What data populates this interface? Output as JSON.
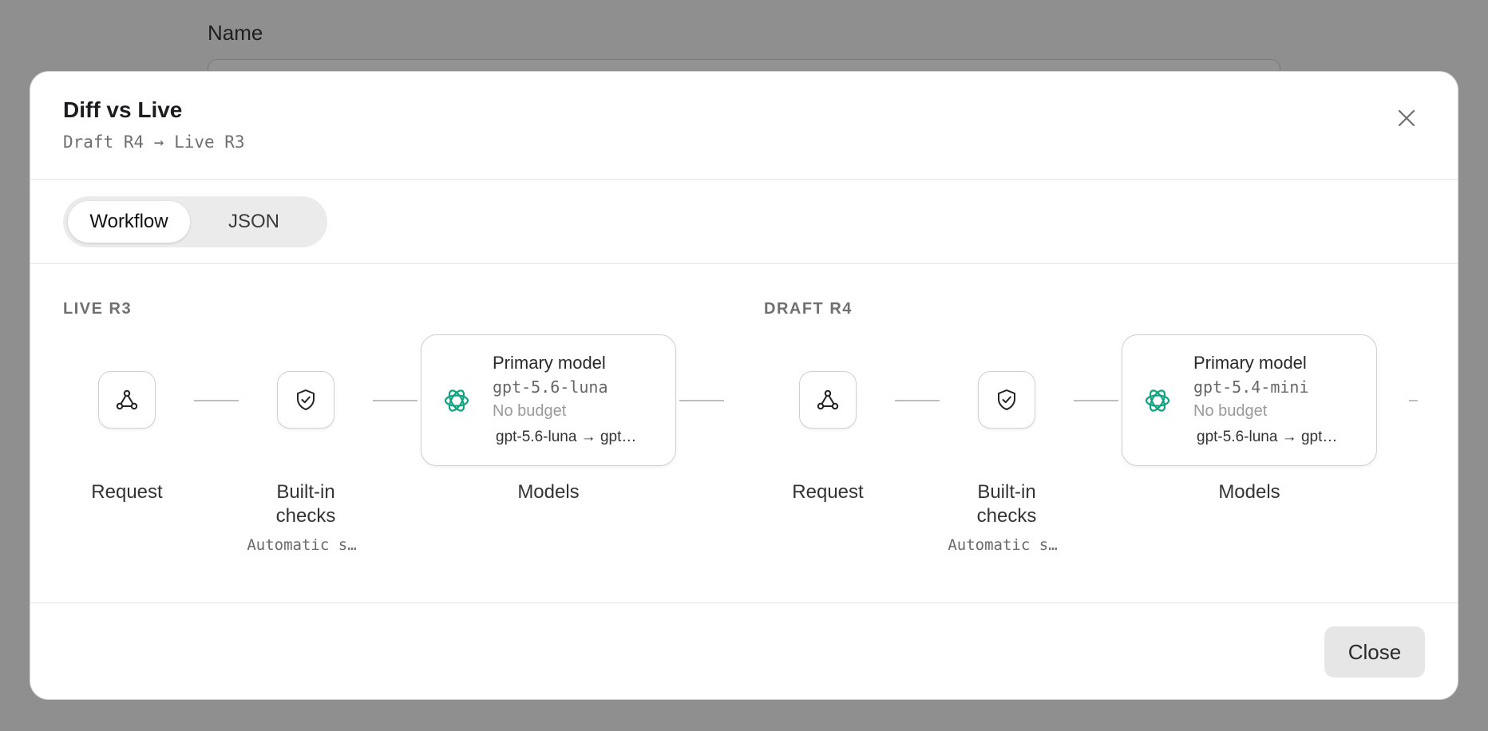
{
  "background": {
    "field_label": "Name"
  },
  "modal": {
    "title": "Diff vs Live",
    "subtitle": "Draft R4 → Live R3",
    "close_icon": "close-icon",
    "tabs": [
      {
        "label": "Workflow",
        "active": true
      },
      {
        "label": "JSON",
        "active": false
      }
    ],
    "footer": {
      "close_label": "Close"
    }
  },
  "live": {
    "label": "LIVE R3",
    "request": {
      "label": "Request",
      "icon": "webhook-icon"
    },
    "checks": {
      "label": "Built-in\nchecks",
      "sub": "Automatic s…",
      "icon": "shield-check-icon"
    },
    "model": {
      "title": "Primary model",
      "model": "gpt-5.6-luna",
      "budget": "No budget",
      "chain": "gpt-5.6-luna → gpt…",
      "icon": "openai-logo-icon",
      "label": "Models"
    }
  },
  "draft": {
    "label": "DRAFT R4",
    "request": {
      "label": "Request",
      "icon": "webhook-icon"
    },
    "checks": {
      "label": "Built-in\nchecks",
      "sub": "Automatic s…",
      "icon": "shield-check-icon"
    },
    "model": {
      "title": "Primary model",
      "model": "gpt-5.4-mini",
      "budget": "No budget",
      "chain": "gpt-5.6-luna → gpt…",
      "icon": "openai-logo-icon",
      "label": "Models"
    }
  },
  "colors": {
    "overlay": "#8f8f8f",
    "openai_green": "#10a37f",
    "connector": "#bdbdbd"
  }
}
